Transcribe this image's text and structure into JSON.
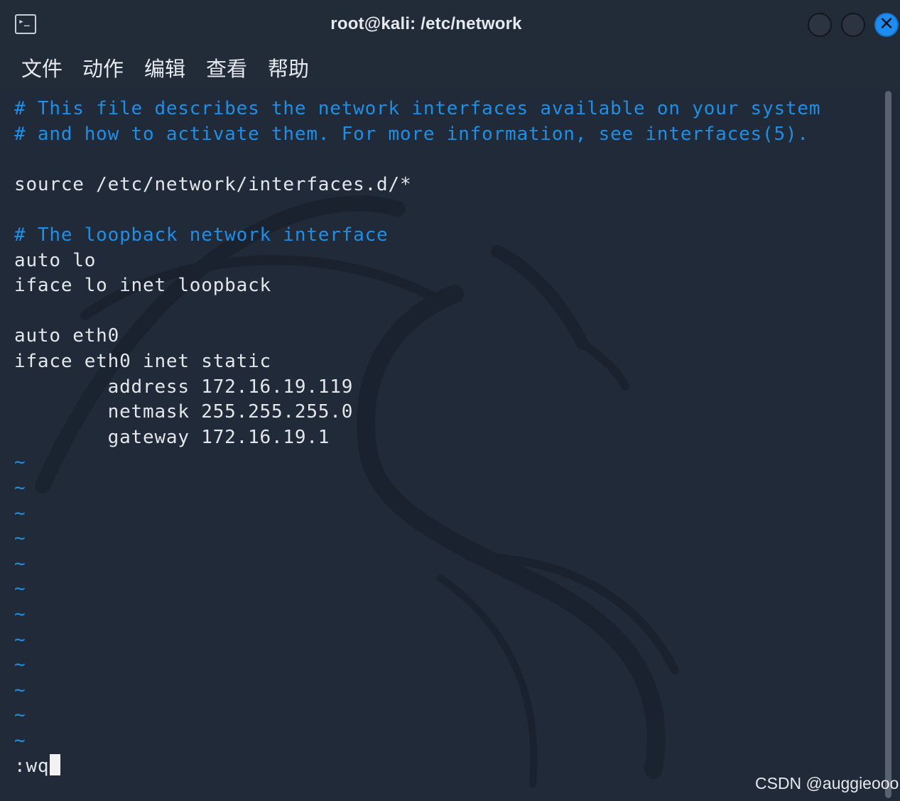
{
  "window": {
    "title": "root@kali: /etc/network",
    "close_glyph": "✕",
    "app_icon_glyph": "▸_"
  },
  "menu": [
    "文件",
    "动作",
    "编辑",
    "查看",
    "帮助"
  ],
  "editor": {
    "lines": [
      {
        "type": "comment",
        "text": "# This file describes the network interfaces available on your system"
      },
      {
        "type": "comment",
        "text": "# and how to activate them. For more information, see interfaces(5)."
      },
      {
        "type": "blank",
        "text": ""
      },
      {
        "type": "code",
        "text": "source /etc/network/interfaces.d/*"
      },
      {
        "type": "blank",
        "text": ""
      },
      {
        "type": "comment",
        "text": "# The loopback network interface"
      },
      {
        "type": "code",
        "text": "auto lo"
      },
      {
        "type": "code",
        "text": "iface lo inet loopback"
      },
      {
        "type": "blank",
        "text": ""
      },
      {
        "type": "code",
        "text": "auto eth0"
      },
      {
        "type": "code",
        "text": "iface eth0 inet static"
      },
      {
        "type": "code",
        "text": "        address 172.16.19.119"
      },
      {
        "type": "code",
        "text": "        netmask 255.255.255.0"
      },
      {
        "type": "code",
        "text": "        gateway 172.16.19.1"
      }
    ],
    "tilde_char": "~",
    "tilde_count": 12,
    "command_line": ":wq"
  },
  "watermark_text": "CSDN @auggieooo",
  "colors": {
    "background": "#212a38",
    "comment": "#1e8fe6",
    "text": "#e3e6ea",
    "close_button": "#1f8cf0"
  }
}
